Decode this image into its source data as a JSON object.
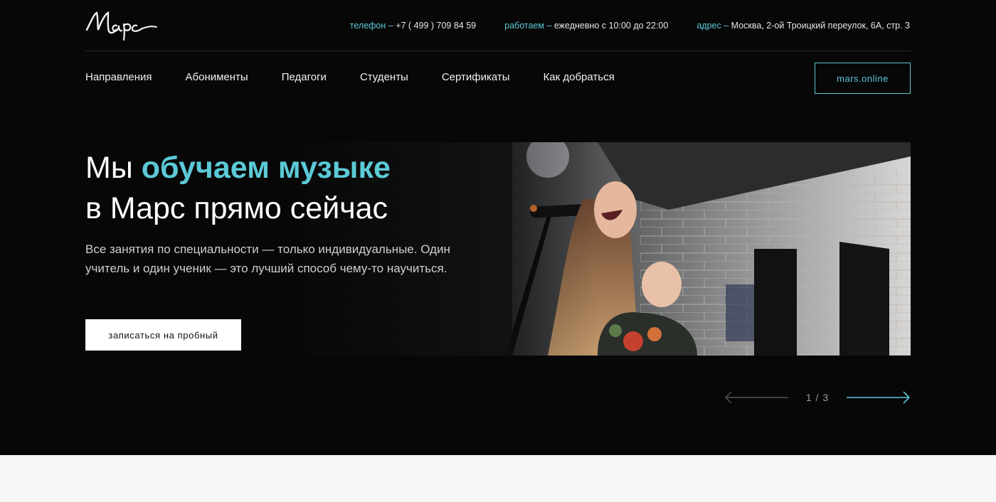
{
  "header": {
    "logo_text": "Марс",
    "contacts": [
      {
        "label": "телефон",
        "dash": " – ",
        "value": "+7 ( 499 ) 709 84 59"
      },
      {
        "label": "работаем",
        "dash": " – ",
        "value": "ежедневно с 10:00 до 22:00"
      },
      {
        "label": "адрес",
        "dash": " – ",
        "value": "Москва, 2-ой Троицкий переулок, 6А, стр. 3"
      }
    ]
  },
  "nav": {
    "items": [
      "Направления",
      "Абонименты",
      "Педагоги",
      "Студенты",
      "Сертификаты",
      "Как добраться"
    ],
    "online_button": "mars.online"
  },
  "hero": {
    "title_prefix": "Мы ",
    "title_accent": "обучаем музыке",
    "title_line2": "в Марс прямо сейчас",
    "subtitle": "Все занятия по специальности — только индивидуальные. Один учитель и один ученик — это лучший способ чему-то научиться.",
    "cta": "записаться на пробный",
    "image_alt_icon": "singer-photo"
  },
  "slider": {
    "counter": "1 / 3",
    "current": 1,
    "total": 3
  },
  "colors": {
    "accent": "#5cc9d6",
    "background": "#070708",
    "page_bottom": "#f7f7f7"
  }
}
